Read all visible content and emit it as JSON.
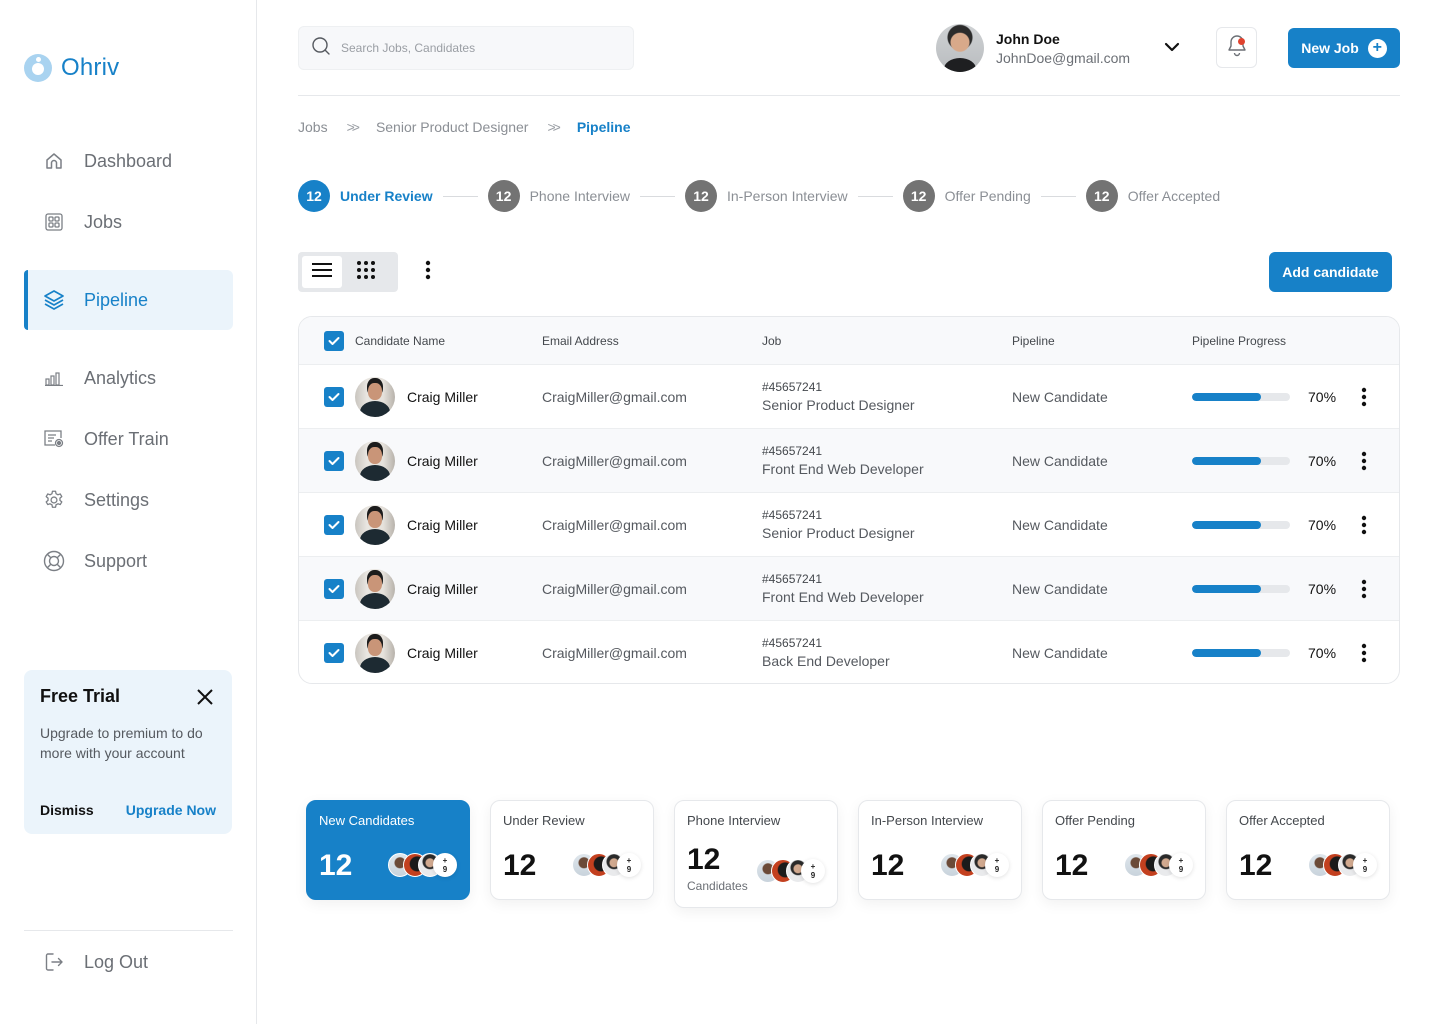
{
  "app": {
    "name": "Ohriv",
    "accent": "#1781c8",
    "notification_dot": "#e0432f"
  },
  "sidebar": {
    "items": [
      {
        "label": "Dashboard",
        "icon": "home-icon",
        "active": false
      },
      {
        "label": "Jobs",
        "icon": "grid-icon",
        "active": false
      },
      {
        "label": "Pipeline",
        "icon": "layers-icon",
        "active": true
      },
      {
        "label": "Analytics",
        "icon": "bar-chart-icon",
        "active": false
      },
      {
        "label": "Offer Train",
        "icon": "certificate-icon",
        "active": false
      },
      {
        "label": "Settings",
        "icon": "gear-icon",
        "active": false
      },
      {
        "label": "Support",
        "icon": "lifebuoy-icon",
        "active": false
      }
    ],
    "trial": {
      "title": "Free Trial",
      "text": "Upgrade to premium to do more with your account",
      "dismiss": "Dismiss",
      "upgrade": "Upgrade Now"
    },
    "logout": "Log Out"
  },
  "header": {
    "search_placeholder": "Search Jobs, Candidates",
    "user": {
      "name": "John Doe",
      "email": "JohnDoe@gmail.com"
    },
    "new_job": "New Job"
  },
  "breadcrumb": [
    "Jobs",
    "Senior Product Designer",
    "Pipeline"
  ],
  "stages": [
    {
      "count": "12",
      "label": "Under Review",
      "active": true
    },
    {
      "count": "12",
      "label": "Phone Interview",
      "active": false
    },
    {
      "count": "12",
      "label": "In-Person Interview",
      "active": false
    },
    {
      "count": "12",
      "label": "Offer Pending",
      "active": false
    },
    {
      "count": "12",
      "label": "Offer Accepted",
      "active": false
    }
  ],
  "toolbar": {
    "add_candidate": "Add candidate",
    "view_mode": "list"
  },
  "table": {
    "headers": {
      "name": "Candidate Name",
      "email": "Email Address",
      "job": "Job",
      "pipeline": "Pipeline",
      "progress": "Pipeline Progress"
    },
    "all_checked": true,
    "rows": [
      {
        "checked": true,
        "name": "Craig Miller",
        "email": "CraigMiller@gmail.com",
        "job_id": "#45657241",
        "job_title": "Senior Product Designer",
        "pipeline": "New Candidate",
        "progress": 70,
        "progress_label": "70%"
      },
      {
        "checked": true,
        "name": "Craig Miller",
        "email": "CraigMiller@gmail.com",
        "job_id": "#45657241",
        "job_title": "Front End Web Developer",
        "pipeline": "New Candidate",
        "progress": 70,
        "progress_label": "70%"
      },
      {
        "checked": true,
        "name": "Craig Miller",
        "email": "CraigMiller@gmail.com",
        "job_id": "#45657241",
        "job_title": "Senior Product Designer",
        "pipeline": "New Candidate",
        "progress": 70,
        "progress_label": "70%"
      },
      {
        "checked": true,
        "name": "Craig Miller",
        "email": "CraigMiller@gmail.com",
        "job_id": "#45657241",
        "job_title": "Front End Web Developer",
        "pipeline": "New Candidate",
        "progress": 70,
        "progress_label": "70%"
      },
      {
        "checked": true,
        "name": "Craig Miller",
        "email": "CraigMiller@gmail.com",
        "job_id": "#45657241",
        "job_title": "Back End Developer",
        "pipeline": "New Candidate",
        "progress": 70,
        "progress_label": "70%"
      }
    ]
  },
  "summary_cards": [
    {
      "title": "New Candidates",
      "count": "12",
      "sub": "",
      "extra": "+9",
      "highlighted": true
    },
    {
      "title": "Under Review",
      "count": "12",
      "sub": "",
      "extra": "+9",
      "highlighted": false
    },
    {
      "title": "Phone Interview",
      "count": "12",
      "sub": "Candidates",
      "extra": "+9",
      "highlighted": false
    },
    {
      "title": "In-Person Interview",
      "count": "12",
      "sub": "",
      "extra": "+9",
      "highlighted": false
    },
    {
      "title": "Offer Pending",
      "count": "12",
      "sub": "",
      "extra": "+9",
      "highlighted": false
    },
    {
      "title": "Offer Accepted",
      "count": "12",
      "sub": "",
      "extra": "+9",
      "highlighted": false
    }
  ]
}
